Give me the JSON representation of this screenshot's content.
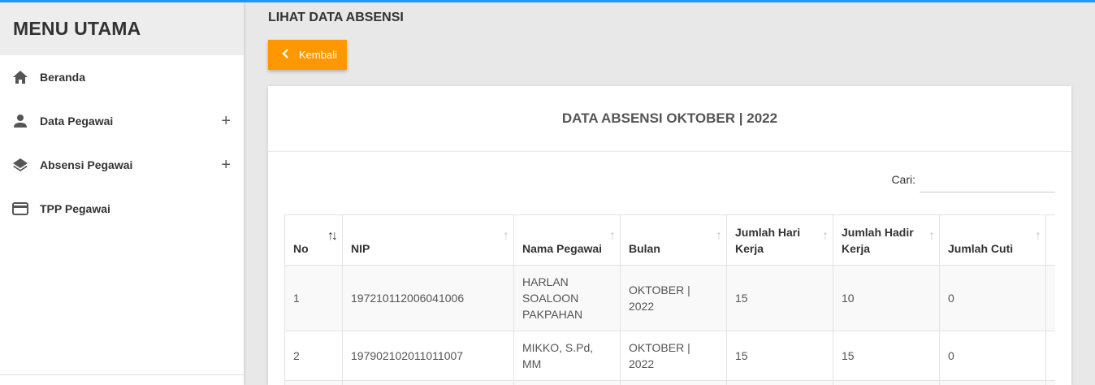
{
  "sidebar": {
    "title": "MENU UTAMA",
    "items": [
      {
        "label": "Beranda",
        "icon": "home-icon",
        "expandable": false
      },
      {
        "label": "Data Pegawai",
        "icon": "person-icon",
        "expandable": true
      },
      {
        "label": "Absensi Pegawai",
        "icon": "layers-icon",
        "expandable": true
      },
      {
        "label": "TPP Pegawai",
        "icon": "credit-card-icon",
        "expandable": false
      }
    ],
    "plus_symbol": "+"
  },
  "page": {
    "title": "LIHAT DATA ABSENSI",
    "back_button": "Kembali"
  },
  "card": {
    "title": "DATA ABSENSI OKTOBER | 2022",
    "search_label": "Cari:",
    "search_value": ""
  },
  "table": {
    "columns": [
      "No",
      "NIP",
      "Nama Pegawai",
      "Bulan",
      "Jumlah Hari Kerja",
      "Jumlah Hadir Kerja",
      "Jumlah Cuti"
    ],
    "rows": [
      [
        "1",
        "197210112006041006",
        "HARLAN SOALOON PAKPAHAN",
        "OKTOBER | 2022",
        "15",
        "10",
        "0"
      ],
      [
        "2",
        "197902102011011007",
        "MIKKO, S.Pd, MM",
        "OKTOBER | 2022",
        "15",
        "15",
        "0"
      ]
    ]
  },
  "colors": {
    "accent_top": "#2196f3",
    "button": "#ff9800"
  }
}
